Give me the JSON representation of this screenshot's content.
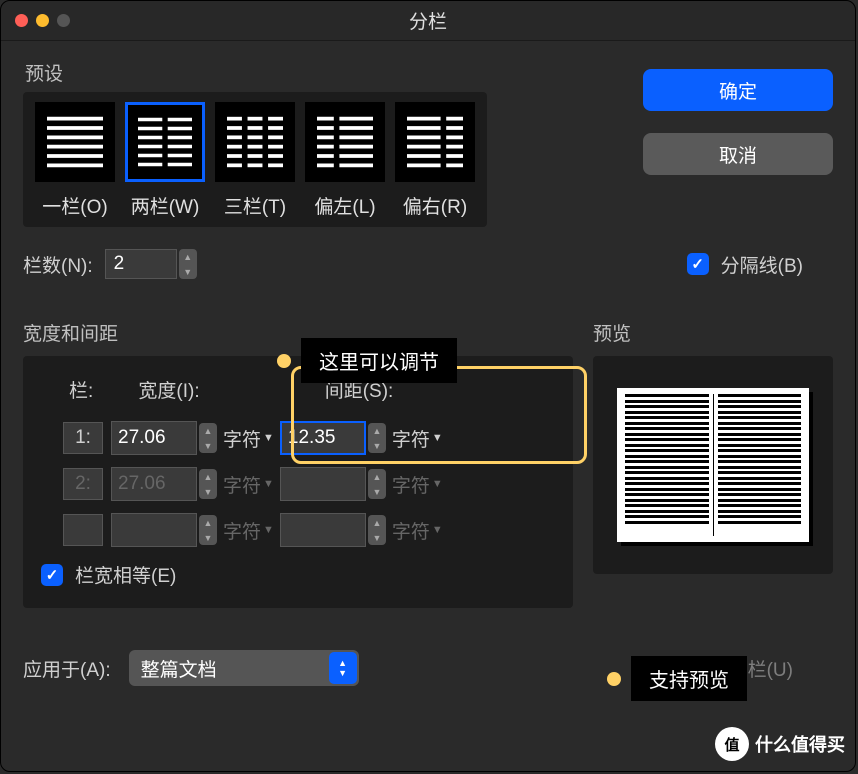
{
  "title": "分栏",
  "presets": {
    "label": "预设",
    "items": [
      {
        "label": "一栏(O)"
      },
      {
        "label": "两栏(W)"
      },
      {
        "label": "三栏(T)"
      },
      {
        "label": "偏左(L)"
      },
      {
        "label": "偏右(R)"
      }
    ]
  },
  "buttons": {
    "ok": "确定",
    "cancel": "取消"
  },
  "count": {
    "label": "栏数(N):",
    "value": "2"
  },
  "separator": {
    "label": "分隔线(B)"
  },
  "tooltips": {
    "t1": "这里可以调节",
    "t2": "支持预览"
  },
  "width_spacing": {
    "label": "宽度和间距",
    "headers": {
      "col": "栏:",
      "width": "宽度(I):",
      "spacing": "间距(S):"
    },
    "unit": "字符",
    "rows": [
      {
        "idx": "1:",
        "width": "27.06",
        "spacing": "12.35"
      },
      {
        "idx": "2:",
        "width": "27.06",
        "spacing": ""
      },
      {
        "idx": "",
        "width": "",
        "spacing": ""
      }
    ],
    "equal": "栏宽相等(E)"
  },
  "preview": {
    "label": "预览"
  },
  "apply": {
    "label": "应用于(A):",
    "value": "整篇文档"
  },
  "newcol": {
    "label": "开始新栏(U)"
  },
  "watermark": {
    "char": "值",
    "text": "什么值得买"
  }
}
